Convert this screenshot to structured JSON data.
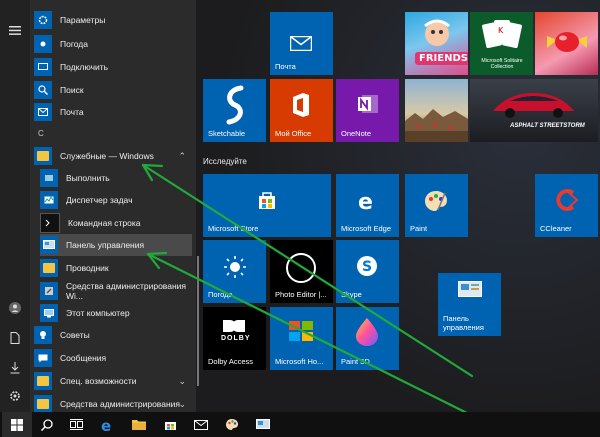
{
  "left_list": {
    "items_top": [
      {
        "label": "Параметры",
        "icon": "gear-icon"
      },
      {
        "label": "Погода",
        "icon": "weather-icon"
      },
      {
        "label": "Подключить",
        "icon": "connect-icon"
      },
      {
        "label": "Поиск",
        "icon": "search-icon"
      },
      {
        "label": "Почта",
        "icon": "mail-icon"
      }
    ],
    "letter_c": "С",
    "folder_windows": "Служебные — Windows",
    "sub_items": [
      {
        "label": "Выполнить",
        "icon": "run-icon"
      },
      {
        "label": "Диспетчер задач",
        "icon": "task-manager-icon"
      },
      {
        "label": "Командная строка",
        "icon": "cmd-icon"
      },
      {
        "label": "Панель управления",
        "icon": "control-panel-icon"
      },
      {
        "label": "Проводник",
        "icon": "folder-icon"
      },
      {
        "label": "Средства администрирования Wi...",
        "icon": "admin-tools-icon"
      },
      {
        "label": "Этот компьютер",
        "icon": "computer-icon"
      }
    ],
    "items_bottom": [
      {
        "label": "Советы",
        "icon": "tips-icon"
      },
      {
        "label": "Сообщения",
        "icon": "messages-icon"
      },
      {
        "label": "Спец. возможности",
        "icon": "folder-icon"
      },
      {
        "label": "Средства администрирования",
        "icon": "folder-icon"
      }
    ]
  },
  "tiles": {
    "mail": "Почта",
    "sketchable": "Sketchable",
    "my_office": "Мой Office",
    "onenote": "OneNote",
    "friends": "FRIENDS",
    "solitaire": "Microsoft Solitaire Collection",
    "asphalt": "ASPHALT STREETSTORM",
    "explore_group": "Исследуйте",
    "store": "Microsoft Store",
    "edge": "Microsoft Edge",
    "paint": "Paint",
    "ccleaner": "CCleaner",
    "weather": "Погода",
    "photo_editor": "Photo Editor |...",
    "skype": "Skype",
    "dolby": "Dolby Access",
    "dolby_logo": "DOLBY",
    "microsoft_home": "Microsoft Ho...",
    "paint3d": "Paint 3D",
    "control_panel": "Панель управления"
  },
  "colors": {
    "tile_blue": "#0063b1",
    "office_red": "#d83b01",
    "onenote_purple": "#7719aa",
    "arrow_green": "#1faa3a"
  }
}
